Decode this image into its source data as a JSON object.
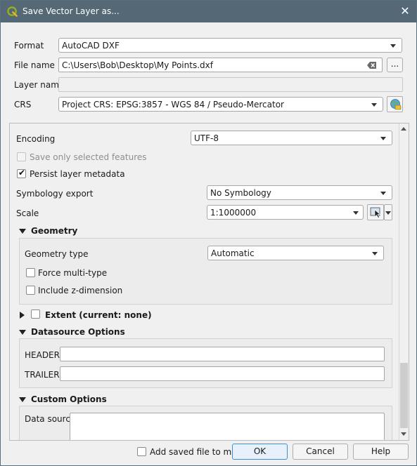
{
  "window": {
    "title": "Save Vector Layer as...",
    "close_glyph": "✕"
  },
  "format": {
    "label": "Format",
    "value": "AutoCAD DXF"
  },
  "file_name": {
    "label": "File name",
    "value": "C:\\Users\\Bob\\Desktop\\My Points.dxf",
    "browse_label": "..."
  },
  "layer_name": {
    "label": "Layer name",
    "value": ""
  },
  "crs": {
    "label": "CRS",
    "value": "Project CRS: EPSG:3857 - WGS 84 / Pseudo-Mercator"
  },
  "options": {
    "encoding": {
      "label": "Encoding",
      "value": "UTF-8"
    },
    "save_selected": {
      "label": "Save only selected features",
      "checked": false,
      "enabled": false
    },
    "persist_metadata": {
      "label": "Persist layer metadata",
      "checked": true
    },
    "symbology_export": {
      "label": "Symbology export",
      "value": "No Symbology"
    },
    "scale": {
      "label": "Scale",
      "value": "1:1000000"
    }
  },
  "geometry": {
    "title": "Geometry",
    "type_label": "Geometry type",
    "type_value": "Automatic",
    "force_multi": {
      "label": "Force multi-type",
      "checked": false
    },
    "include_z": {
      "label": "Include z-dimension",
      "checked": false
    }
  },
  "extent": {
    "title": "Extent (current: none)",
    "checked": false
  },
  "datasource": {
    "title": "Datasource Options",
    "header_label": "HEADER",
    "header_value": "",
    "trailer_label": "TRAILER",
    "trailer_value": ""
  },
  "custom": {
    "title": "Custom Options",
    "data_source_label": "Data source",
    "data_source_value": ""
  },
  "footer": {
    "add_saved": {
      "label": "Add saved file to map",
      "checked": false
    },
    "ok_label": "OK",
    "cancel_label": "Cancel",
    "help_label": "Help"
  },
  "colors": {
    "titlebar": "#546876",
    "accent": "#3a8fd9",
    "qgis_green": "#589632"
  },
  "icons": [
    "qgis-app-icon",
    "close-icon",
    "clear-field-icon",
    "crs-selector-icon",
    "map-canvas-scale-icon",
    "chevron-down-icon",
    "expand-arrow-icon",
    "collapse-arrow-icon"
  ]
}
